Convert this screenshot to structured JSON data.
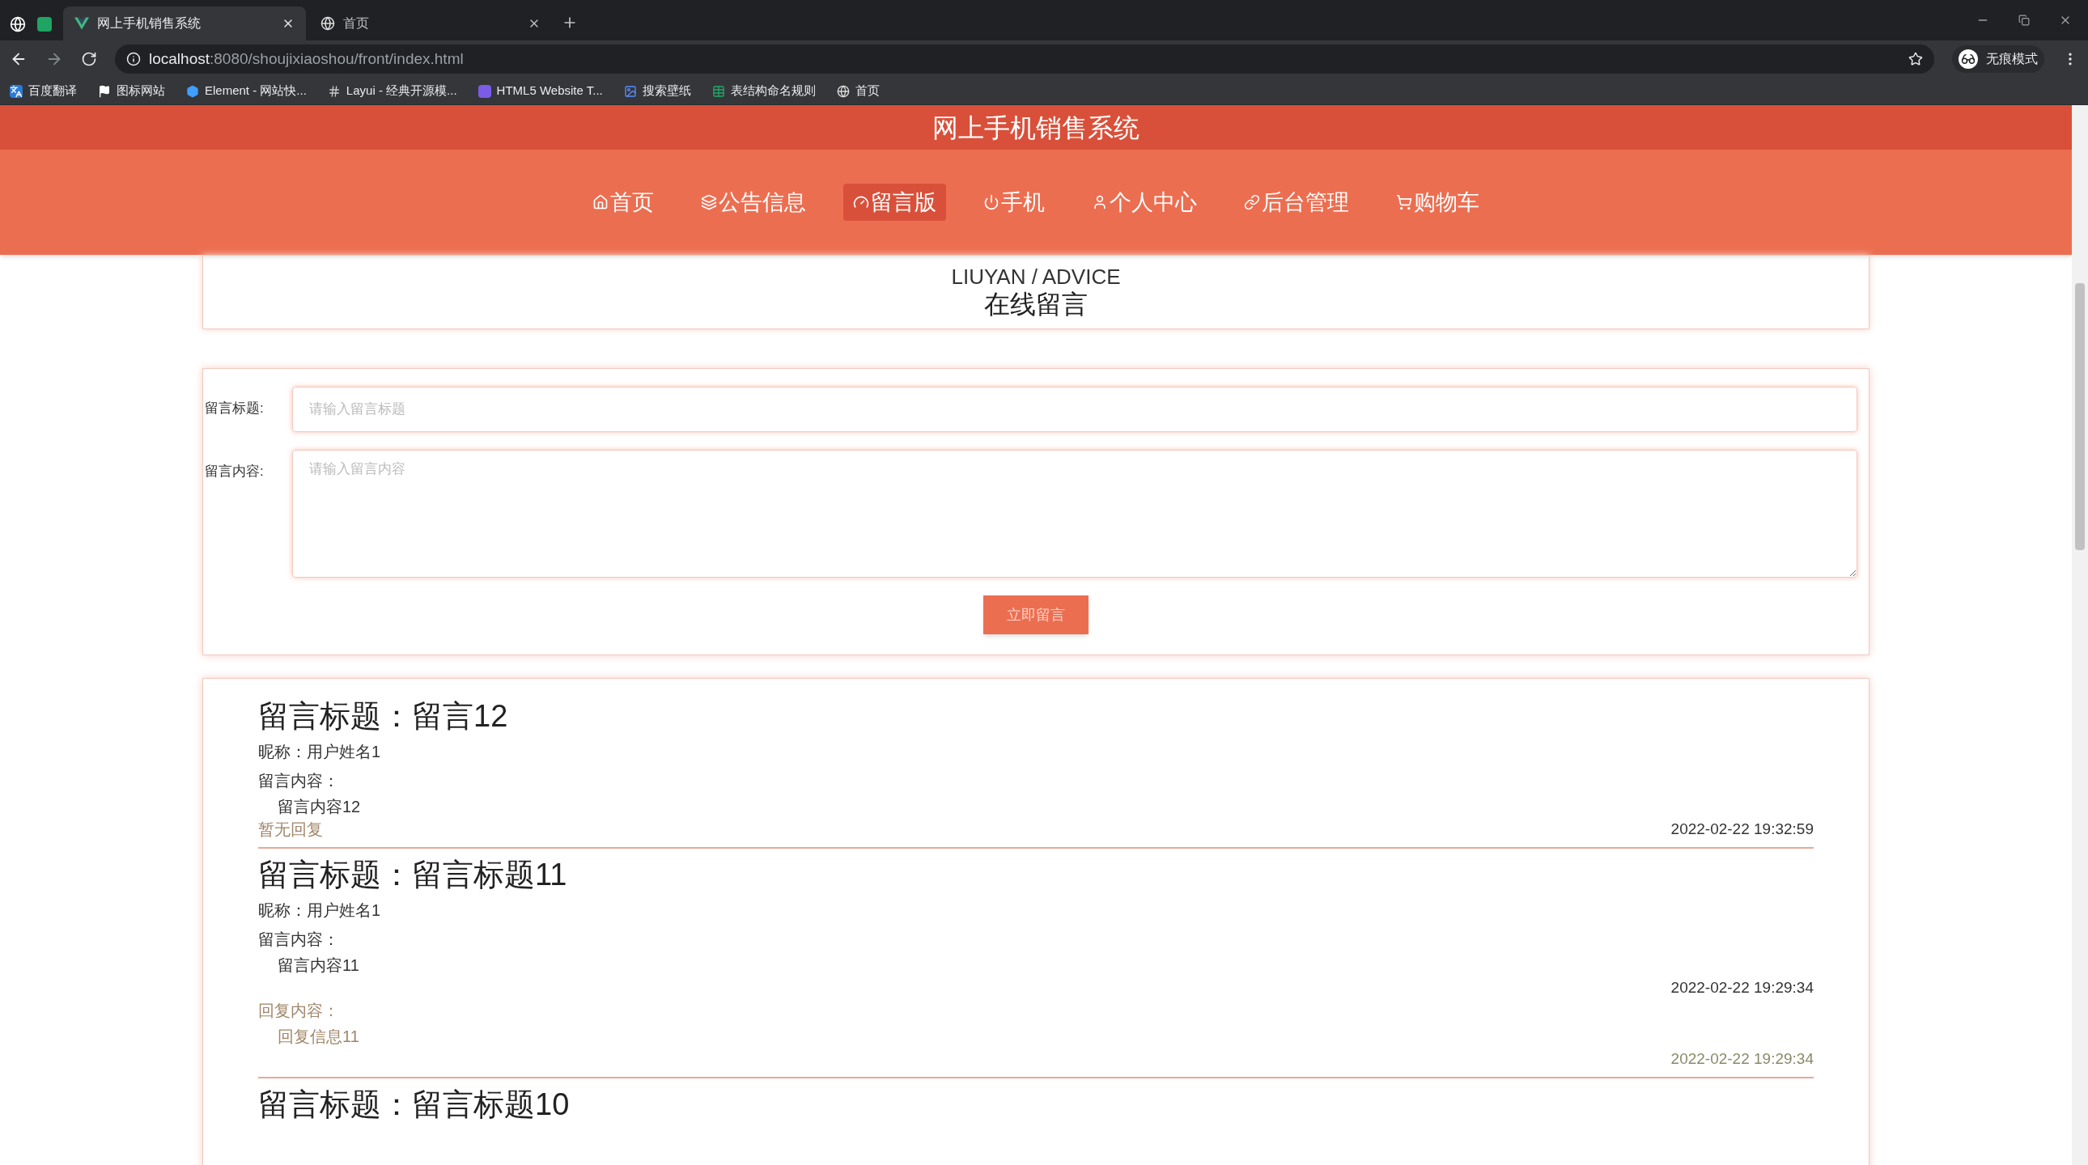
{
  "browser": {
    "tabs": [
      {
        "title": "网上手机销售系统",
        "selected": true
      },
      {
        "title": "首页",
        "selected": false
      }
    ],
    "address": {
      "host": "localhost",
      "path": ":8080/shoujixiaoshou/front/index.html"
    },
    "profile": "无痕模式",
    "bookmarks": [
      "百度翻译",
      "图标网站",
      "Element - 网站快...",
      "Layui - 经典开源模...",
      "HTML5 Website T...",
      "搜索壁纸",
      "表结构命名规则",
      "首页"
    ]
  },
  "site": {
    "title": "网上手机销售系统",
    "nav": [
      {
        "label": "首页",
        "selected": false
      },
      {
        "label": "公告信息",
        "selected": false
      },
      {
        "label": "留言版",
        "selected": true
      },
      {
        "label": "手机",
        "selected": false
      },
      {
        "label": "个人中心",
        "selected": false
      },
      {
        "label": "后台管理",
        "selected": false
      },
      {
        "label": "购物车",
        "selected": false
      }
    ]
  },
  "heading": {
    "subtitle": "LIUYAN / ADVICE",
    "title": "在线留言"
  },
  "form": {
    "fields": [
      {
        "label": "留言标题:",
        "placeholder": "请输入留言标题",
        "kind": "input"
      },
      {
        "label": "留言内容:",
        "placeholder": "请输入留言内容",
        "kind": "textarea"
      }
    ],
    "submit": "立即留言"
  },
  "messages": [
    {
      "title": "留言标题：留言12",
      "nickname": "昵称：用户姓名1",
      "content_label": "留言内容：",
      "content": "留言内容12",
      "no_reply": "暂无回复",
      "time": "2022-02-22 19:32:59"
    },
    {
      "title": "留言标题：留言标题11",
      "nickname": "昵称：用户姓名1",
      "content_label": "留言内容：",
      "content": "留言内容11",
      "time": "2022-02-22 19:29:34",
      "reply_label": "回复内容：",
      "reply": "回复信息11",
      "reply_time": "2022-02-22 19:29:34"
    },
    {
      "title": "留言标题：留言标题10"
    }
  ]
}
